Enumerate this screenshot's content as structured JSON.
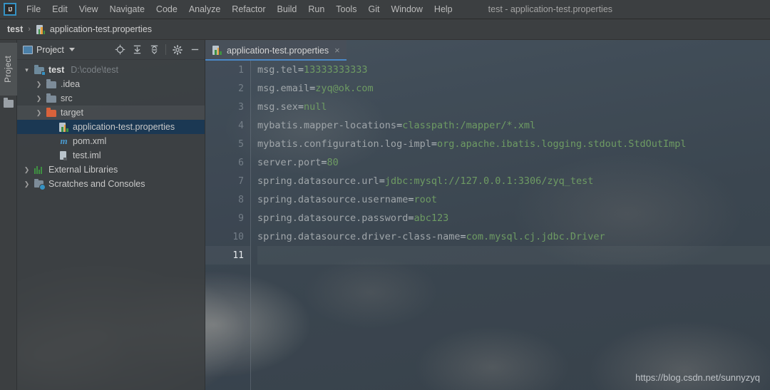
{
  "window": {
    "title": "test - application-test.properties",
    "logo_text": "IJ"
  },
  "menubar": {
    "items": [
      {
        "label": "File"
      },
      {
        "label": "Edit"
      },
      {
        "label": "View"
      },
      {
        "label": "Navigate"
      },
      {
        "label": "Code"
      },
      {
        "label": "Analyze"
      },
      {
        "label": "Refactor"
      },
      {
        "label": "Build"
      },
      {
        "label": "Run"
      },
      {
        "label": "Tools"
      },
      {
        "label": "Git"
      },
      {
        "label": "Window"
      },
      {
        "label": "Help"
      }
    ]
  },
  "navbar": {
    "project": "test",
    "separator": "›",
    "file": "application-test.properties"
  },
  "toolstrip": {
    "project_tab": "Project"
  },
  "project_panel": {
    "title": "Project",
    "tools": [
      {
        "name": "locate-icon",
        "tooltip": "Select Opened File"
      },
      {
        "name": "expand-all-icon",
        "tooltip": "Expand All"
      },
      {
        "name": "collapse-all-icon",
        "tooltip": "Collapse All"
      },
      {
        "name": "gear-icon",
        "tooltip": "Settings"
      },
      {
        "name": "minimize-icon",
        "tooltip": "Hide"
      }
    ],
    "tree": [
      {
        "label": "test",
        "path": "D:\\code\\test",
        "icon": "module-icon",
        "arrow": "down",
        "indent": 0,
        "state": "normal",
        "bold": true
      },
      {
        "label": ".idea",
        "path": "",
        "icon": "folder-icon",
        "arrow": "right",
        "indent": 1,
        "state": "normal",
        "bold": false
      },
      {
        "label": "src",
        "path": "",
        "icon": "folder-icon",
        "arrow": "right",
        "indent": 1,
        "state": "normal",
        "bold": false
      },
      {
        "label": "target",
        "path": "",
        "icon": "folder-orange-icon",
        "arrow": "right",
        "indent": 1,
        "state": "hover",
        "bold": false
      },
      {
        "label": "application-test.properties",
        "path": "",
        "icon": "properties-file-icon",
        "arrow": "none",
        "indent": 2,
        "state": "selected",
        "bold": false
      },
      {
        "label": "pom.xml",
        "path": "",
        "icon": "maven-file-icon",
        "arrow": "none",
        "indent": 2,
        "state": "normal",
        "bold": false
      },
      {
        "label": "test.iml",
        "path": "",
        "icon": "iml-file-icon",
        "arrow": "none",
        "indent": 2,
        "state": "normal",
        "bold": false
      },
      {
        "label": "External Libraries",
        "path": "",
        "icon": "library-icon",
        "arrow": "right",
        "indent": 0,
        "state": "normal",
        "bold": false
      },
      {
        "label": "Scratches and Consoles",
        "path": "",
        "icon": "scratches-icon",
        "arrow": "right",
        "indent": 0,
        "state": "normal",
        "bold": false
      }
    ]
  },
  "editor": {
    "tabs": [
      {
        "label": "application-test.properties",
        "icon": "properties-file-icon",
        "close": "×",
        "active": true
      }
    ],
    "current_line": 11,
    "lines": [
      {
        "no": 1,
        "key": "msg.tel",
        "eq": "=",
        "value": "13333333333"
      },
      {
        "no": 2,
        "key": "msg.email",
        "eq": "=",
        "value": "zyq@ok.com"
      },
      {
        "no": 3,
        "key": "msg.sex",
        "eq": "=",
        "value": "null"
      },
      {
        "no": 4,
        "key": "mybatis.mapper-locations",
        "eq": "=",
        "value": "classpath:/mapper/*.xml"
      },
      {
        "no": 5,
        "key": "mybatis.configuration.log-impl",
        "eq": "=",
        "value": "org.apache.ibatis.logging.stdout.StdOutImpl"
      },
      {
        "no": 6,
        "key": "server.port",
        "eq": "=",
        "value": "80"
      },
      {
        "no": 7,
        "key": "spring.datasource.url",
        "eq": "=",
        "value": "jdbc:mysql://127.0.0.1:3306/zyq_test"
      },
      {
        "no": 8,
        "key": "spring.datasource.username",
        "eq": "=",
        "value": "root"
      },
      {
        "no": 9,
        "key": "spring.datasource.password",
        "eq": "=",
        "value": "abc123"
      },
      {
        "no": 10,
        "key": "spring.datasource.driver-class-name",
        "eq": "=",
        "value": "com.mysql.cj.jdbc.Driver"
      },
      {
        "no": 11,
        "key": "",
        "eq": "",
        "value": ""
      }
    ]
  },
  "watermark": {
    "text": "https://blog.csdn.net/sunnyzyq"
  },
  "colors": {
    "accent_blue": "#3592c4",
    "selection_blue": "#1b3853",
    "tab_underline": "#4a88c7",
    "value_green": "#6e9b63",
    "key_gray": "#a0a6aa",
    "folder_orange": "#d9623b",
    "panel_bg": "#3c3f41"
  }
}
